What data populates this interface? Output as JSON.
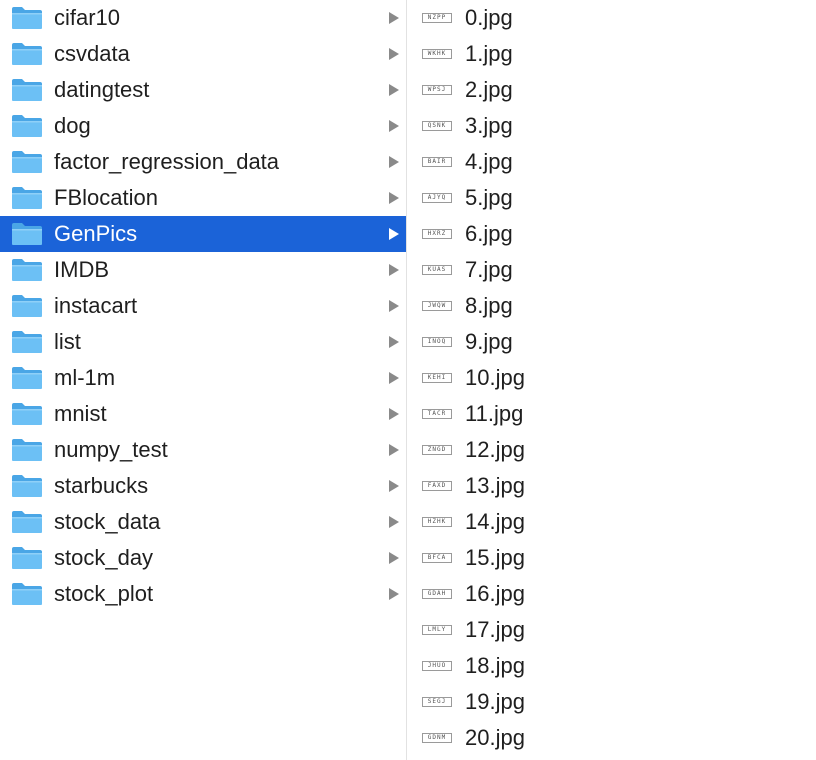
{
  "colors": {
    "selection": "#1b63d8",
    "folder": "#5db4ef",
    "text": "#1f1f1f"
  },
  "folders": [
    {
      "name": "cifar10",
      "selected": false
    },
    {
      "name": "csvdata",
      "selected": false
    },
    {
      "name": "datingtest",
      "selected": false
    },
    {
      "name": "dog",
      "selected": false
    },
    {
      "name": "factor_regression_data",
      "selected": false
    },
    {
      "name": "FBlocation",
      "selected": false
    },
    {
      "name": "GenPics",
      "selected": true
    },
    {
      "name": "IMDB",
      "selected": false
    },
    {
      "name": "instacart",
      "selected": false
    },
    {
      "name": "list",
      "selected": false
    },
    {
      "name": "ml-1m",
      "selected": false
    },
    {
      "name": "mnist",
      "selected": false
    },
    {
      "name": "numpy_test",
      "selected": false
    },
    {
      "name": "starbucks",
      "selected": false
    },
    {
      "name": "stock_data",
      "selected": false
    },
    {
      "name": "stock_day",
      "selected": false
    },
    {
      "name": "stock_plot",
      "selected": false
    }
  ],
  "files": [
    {
      "name": "0.jpg",
      "thumb_text": "NZPP"
    },
    {
      "name": "1.jpg",
      "thumb_text": "WKHK"
    },
    {
      "name": "2.jpg",
      "thumb_text": "WPSJ"
    },
    {
      "name": "3.jpg",
      "thumb_text": "QSNK"
    },
    {
      "name": "4.jpg",
      "thumb_text": "BAIR"
    },
    {
      "name": "5.jpg",
      "thumb_text": "AJYQ"
    },
    {
      "name": "6.jpg",
      "thumb_text": "HXRZ"
    },
    {
      "name": "7.jpg",
      "thumb_text": "KUAS"
    },
    {
      "name": "8.jpg",
      "thumb_text": "JWQW"
    },
    {
      "name": "9.jpg",
      "thumb_text": "INOQ"
    },
    {
      "name": "10.jpg",
      "thumb_text": "KEHI"
    },
    {
      "name": "11.jpg",
      "thumb_text": "TACR"
    },
    {
      "name": "12.jpg",
      "thumb_text": "ZNGD"
    },
    {
      "name": "13.jpg",
      "thumb_text": "FAXD"
    },
    {
      "name": "14.jpg",
      "thumb_text": "HZHK"
    },
    {
      "name": "15.jpg",
      "thumb_text": "BFCA"
    },
    {
      "name": "16.jpg",
      "thumb_text": "GDAH"
    },
    {
      "name": "17.jpg",
      "thumb_text": "LMLY"
    },
    {
      "name": "18.jpg",
      "thumb_text": "JHUO"
    },
    {
      "name": "19.jpg",
      "thumb_text": "SEGJ"
    },
    {
      "name": "20.jpg",
      "thumb_text": "GDNM"
    }
  ]
}
